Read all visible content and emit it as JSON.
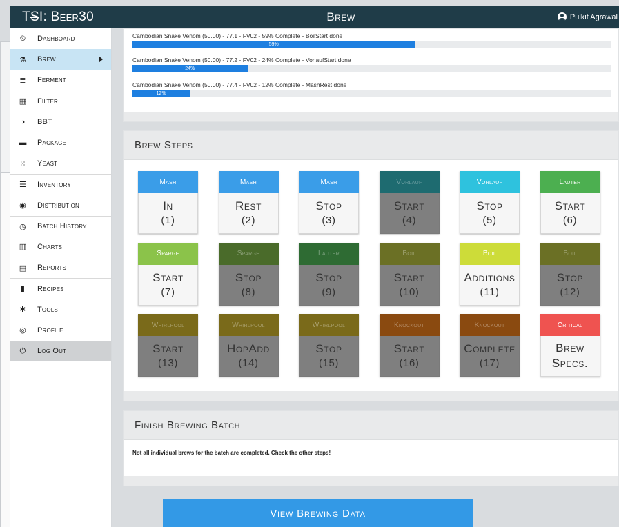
{
  "app": {
    "brand_prefix": "T",
    "brand_mark": "S",
    "brand_suffix": "I: ",
    "brand_name": "Beer30",
    "page_title": "Brew"
  },
  "user": {
    "name": "Pulkit Agrawal"
  },
  "sidebar": {
    "items": [
      {
        "label": "Dashboard",
        "icon": "dashboard-icon",
        "glyph": "⏲"
      },
      {
        "label": "Brew",
        "icon": "flask-icon",
        "glyph": "⚗"
      },
      {
        "label": "Ferment",
        "icon": "database-icon",
        "glyph": "≣"
      },
      {
        "label": "Filter",
        "icon": "grid-icon",
        "glyph": "▦"
      },
      {
        "label": "BBT",
        "icon": "contrast-icon",
        "glyph": "◑"
      },
      {
        "label": "Package",
        "icon": "archive-icon",
        "glyph": "▬"
      },
      {
        "label": "Yeast",
        "icon": "yeast-icon",
        "glyph": "⁙"
      },
      {
        "label": "Inventory",
        "icon": "list-icon",
        "glyph": "☰"
      },
      {
        "label": "Distribution",
        "icon": "globe-icon",
        "glyph": "◉"
      },
      {
        "label": "Batch History",
        "icon": "clock-icon",
        "glyph": "◷"
      },
      {
        "label": "Charts",
        "icon": "bar-chart-icon",
        "glyph": "▥"
      },
      {
        "label": "Reports",
        "icon": "calculator-icon",
        "glyph": "▤"
      },
      {
        "label": "Recipes",
        "icon": "bookmark-icon",
        "glyph": "▮"
      },
      {
        "label": "Tools",
        "icon": "gear-icon",
        "glyph": "✱"
      },
      {
        "label": "Profile",
        "icon": "user-circle-icon",
        "glyph": "◎"
      },
      {
        "label": "Log Out",
        "icon": "power-icon",
        "glyph": "⏻"
      }
    ]
  },
  "progress": [
    {
      "label": "Cambodian Snake Venom (50.00) - 77.1 - FV02 - 59% Complete - BoilStart done",
      "percent": 59,
      "percent_label": "59%"
    },
    {
      "label": "Cambodian Snake Venom (50.00) - 77.2 - FV02 - 24% Complete - VorlaufStart done",
      "percent": 24,
      "percent_label": "24%"
    },
    {
      "label": "Cambodian Snake Venom (50.00) - 77.4 - FV02 - 12% Complete - MashRest done",
      "percent": 12,
      "percent_label": "12%"
    }
  ],
  "steps_panel": {
    "title": "Brew Steps"
  },
  "steps": [
    {
      "phase": "Mash",
      "action": "In",
      "num": "(1)",
      "color": "#3a9de8",
      "dim": false
    },
    {
      "phase": "Mash",
      "action": "Rest",
      "num": "(2)",
      "color": "#3a9de8",
      "dim": false
    },
    {
      "phase": "Mash",
      "action": "Stop",
      "num": "(3)",
      "color": "#3a9de8",
      "dim": false
    },
    {
      "phase": "Vorlauf",
      "action": "Start",
      "num": "(4)",
      "color": "#1e6b70",
      "dim": true
    },
    {
      "phase": "Vorlauf",
      "action": "Stop",
      "num": "(5)",
      "color": "#2ec2de",
      "dim": false
    },
    {
      "phase": "Lauter",
      "action": "Start",
      "num": "(6)",
      "color": "#4caf50",
      "dim": false
    },
    {
      "phase": "Sparge",
      "action": "Start",
      "num": "(7)",
      "color": "#8bc34a",
      "dim": false
    },
    {
      "phase": "Sparge",
      "action": "Stop",
      "num": "(8)",
      "color": "#4a6b2a",
      "dim": true
    },
    {
      "phase": "Lauter",
      "action": "Stop",
      "num": "(9)",
      "color": "#2e6b33",
      "dim": true
    },
    {
      "phase": "Boil",
      "action": "Start",
      "num": "(10)",
      "color": "#6b7025",
      "dim": true
    },
    {
      "phase": "Boil",
      "action": "Additions",
      "num": "(11)",
      "color": "#cddc39",
      "dim": false
    },
    {
      "phase": "Boil",
      "action": "Stop",
      "num": "(12)",
      "color": "#6b7025",
      "dim": true
    },
    {
      "phase": "Whirlpool",
      "action": "Start",
      "num": "(13)",
      "color": "#7a6a1a",
      "dim": true
    },
    {
      "phase": "Whirlpool",
      "action": "HopAdd",
      "num": "(14)",
      "color": "#7a6a1a",
      "dim": true
    },
    {
      "phase": "Whirlpool",
      "action": "Stop",
      "num": "(15)",
      "color": "#7a6a1a",
      "dim": true
    },
    {
      "phase": "Knockout",
      "action": "Start",
      "num": "(16)",
      "color": "#8a4a10",
      "dim": true
    },
    {
      "phase": "Knockout",
      "action": "Complete",
      "num": "(17)",
      "color": "#8a4a10",
      "dim": true
    },
    {
      "phase": "Critical",
      "action": "Brew",
      "num": "Specs.",
      "color": "#ef5350",
      "dim": false,
      "specs": true
    }
  ],
  "finish_panel": {
    "title": "Finish Brewing Batch",
    "message": "Not all individual brews for the batch are completed. Check the other steps!"
  },
  "view_button": {
    "label": "View Brewing Data"
  }
}
